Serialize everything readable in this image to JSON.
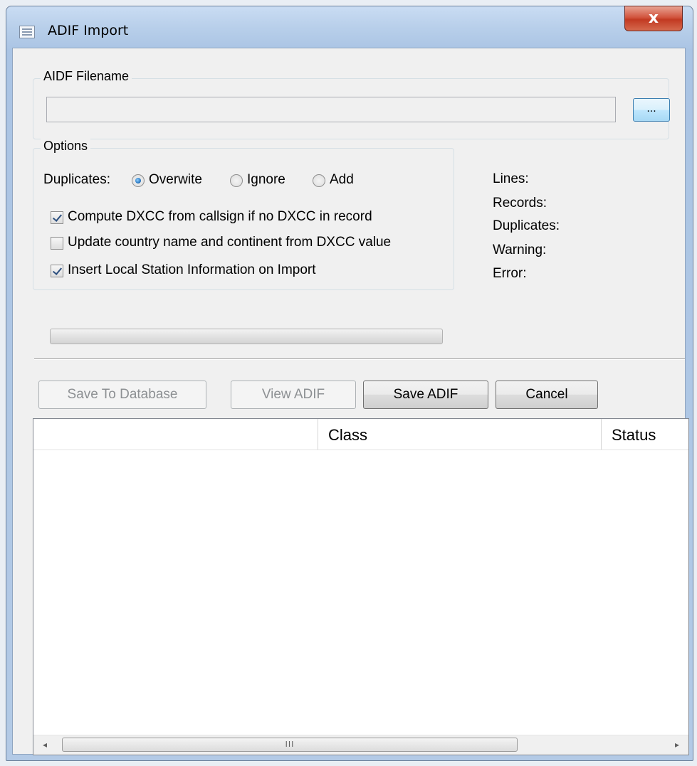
{
  "window": {
    "title": "ADIF Import",
    "close_glyph": "x"
  },
  "filename_group": {
    "caption": "AIDF Filename",
    "input_value": "",
    "browse_label": "..."
  },
  "options_group": {
    "caption": "Options",
    "duplicates_label": "Duplicates:",
    "duplicates_options": [
      {
        "label": "Overwite",
        "checked": true
      },
      {
        "label": "Ignore",
        "checked": false
      },
      {
        "label": "Add",
        "checked": false
      }
    ],
    "checkboxes": [
      {
        "label": "Compute DXCC from callsign if no DXCC in record",
        "checked": true
      },
      {
        "label": "Update country name and continent from DXCC value",
        "checked": false
      },
      {
        "label": "Insert Local Station Information on Import",
        "checked": true
      }
    ]
  },
  "stats": {
    "lines": "Lines:",
    "records": "Records:",
    "duplicates": "Duplicates:",
    "warning": "Warning:",
    "error": "Error:"
  },
  "progress": {
    "value": 0
  },
  "buttons": {
    "save_to_database": "Save To Database",
    "view_adif": "View ADIF",
    "save_adif": "Save ADIF",
    "cancel": "Cancel"
  },
  "list": {
    "columns": [
      "",
      "Class",
      "Status"
    ],
    "rows": []
  },
  "scrollbar": {
    "left_arrow": "◂",
    "right_arrow": "▸",
    "thumb_grip": "III"
  }
}
